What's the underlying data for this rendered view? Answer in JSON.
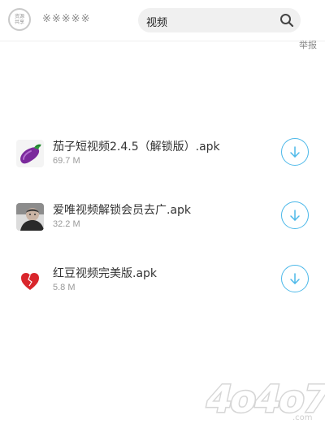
{
  "header": {
    "logo_text": [
      "资源",
      "共享"
    ],
    "site_name": "※※※※※",
    "search": {
      "value": "视频"
    },
    "report_link": "举报"
  },
  "files": [
    {
      "name": "茄子短视频2.4.5（解锁版）.apk",
      "size": "69.7 M",
      "icon": "eggplant-icon"
    },
    {
      "name": "爱唯视频解锁会员去广.apk",
      "size": "32.2 M",
      "icon": "user-photo-icon"
    },
    {
      "name": "红豆视频完美版.apk",
      "size": "5.8 M",
      "icon": "heart-icon"
    }
  ],
  "watermark": "4o4o7.com",
  "colors": {
    "accent": "#4cb8e9",
    "search_bg": "#f0f0f0",
    "heart": "#d9262c",
    "eggplant": "#7b2a9c"
  }
}
